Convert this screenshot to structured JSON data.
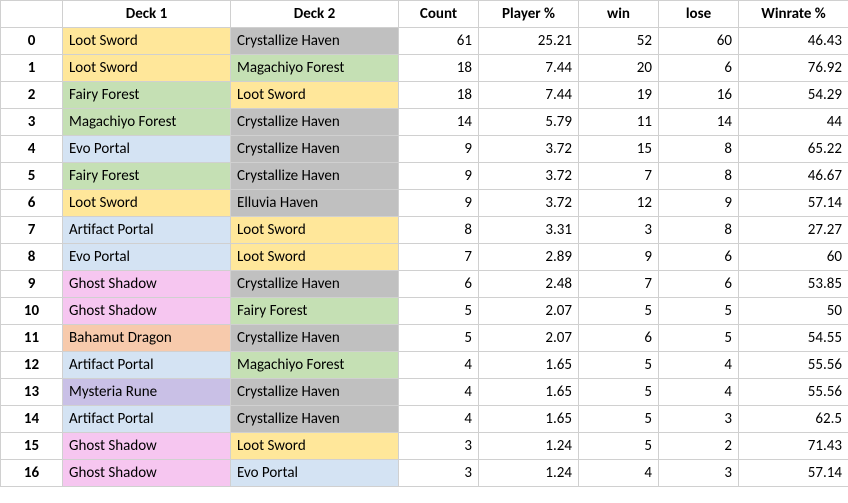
{
  "headers": {
    "idx": "",
    "deck1": "Deck 1",
    "deck2": "Deck 2",
    "count": "Count",
    "playerPct": "Player %",
    "win": "win",
    "lose": "lose",
    "winrate": "Winrate %"
  },
  "deckColors": {
    "Loot Sword": "sword",
    "Crystallize Haven": "haven",
    "Elluvia Haven": "haven",
    "Magachiyo Forest": "forest",
    "Fairy Forest": "forest",
    "Evo Portal": "portal",
    "Artifact Portal": "portal",
    "Ghost Shadow": "shadow",
    "Bahamut Dragon": "dragon",
    "Mysteria Rune": "rune"
  },
  "rows": [
    {
      "idx": "0",
      "deck1": "Loot Sword",
      "deck2": "Crystallize Haven",
      "count": "61",
      "playerPct": "25.21",
      "win": "52",
      "lose": "60",
      "winrate": "46.43"
    },
    {
      "idx": "1",
      "deck1": "Loot Sword",
      "deck2": "Magachiyo Forest",
      "count": "18",
      "playerPct": "7.44",
      "win": "20",
      "lose": "6",
      "winrate": "76.92"
    },
    {
      "idx": "2",
      "deck1": "Fairy Forest",
      "deck2": "Loot Sword",
      "count": "18",
      "playerPct": "7.44",
      "win": "19",
      "lose": "16",
      "winrate": "54.29"
    },
    {
      "idx": "3",
      "deck1": "Magachiyo Forest",
      "deck2": "Crystallize Haven",
      "count": "14",
      "playerPct": "5.79",
      "win": "11",
      "lose": "14",
      "winrate": "44"
    },
    {
      "idx": "4",
      "deck1": "Evo Portal",
      "deck2": "Crystallize Haven",
      "count": "9",
      "playerPct": "3.72",
      "win": "15",
      "lose": "8",
      "winrate": "65.22"
    },
    {
      "idx": "5",
      "deck1": "Fairy Forest",
      "deck2": "Crystallize Haven",
      "count": "9",
      "playerPct": "3.72",
      "win": "7",
      "lose": "8",
      "winrate": "46.67"
    },
    {
      "idx": "6",
      "deck1": "Loot Sword",
      "deck2": "Elluvia Haven",
      "count": "9",
      "playerPct": "3.72",
      "win": "12",
      "lose": "9",
      "winrate": "57.14"
    },
    {
      "idx": "7",
      "deck1": "Artifact Portal",
      "deck2": "Loot Sword",
      "count": "8",
      "playerPct": "3.31",
      "win": "3",
      "lose": "8",
      "winrate": "27.27"
    },
    {
      "idx": "8",
      "deck1": "Evo Portal",
      "deck2": "Loot Sword",
      "count": "7",
      "playerPct": "2.89",
      "win": "9",
      "lose": "6",
      "winrate": "60"
    },
    {
      "idx": "9",
      "deck1": "Ghost Shadow",
      "deck2": "Crystallize Haven",
      "count": "6",
      "playerPct": "2.48",
      "win": "7",
      "lose": "6",
      "winrate": "53.85"
    },
    {
      "idx": "10",
      "deck1": "Ghost Shadow",
      "deck2": "Fairy Forest",
      "count": "5",
      "playerPct": "2.07",
      "win": "5",
      "lose": "5",
      "winrate": "50"
    },
    {
      "idx": "11",
      "deck1": "Bahamut Dragon",
      "deck2": "Crystallize Haven",
      "count": "5",
      "playerPct": "2.07",
      "win": "6",
      "lose": "5",
      "winrate": "54.55"
    },
    {
      "idx": "12",
      "deck1": "Artifact Portal",
      "deck2": "Magachiyo Forest",
      "count": "4",
      "playerPct": "1.65",
      "win": "5",
      "lose": "4",
      "winrate": "55.56"
    },
    {
      "idx": "13",
      "deck1": "Mysteria Rune",
      "deck2": "Crystallize Haven",
      "count": "4",
      "playerPct": "1.65",
      "win": "5",
      "lose": "4",
      "winrate": "55.56"
    },
    {
      "idx": "14",
      "deck1": "Artifact Portal",
      "deck2": "Crystallize Haven",
      "count": "4",
      "playerPct": "1.65",
      "win": "5",
      "lose": "3",
      "winrate": "62.5"
    },
    {
      "idx": "15",
      "deck1": "Ghost Shadow",
      "deck2": "Loot Sword",
      "count": "3",
      "playerPct": "1.24",
      "win": "5",
      "lose": "2",
      "winrate": "71.43"
    },
    {
      "idx": "16",
      "deck1": "Ghost Shadow",
      "deck2": "Evo Portal",
      "count": "3",
      "playerPct": "1.24",
      "win": "4",
      "lose": "3",
      "winrate": "57.14"
    }
  ],
  "chart_data": {
    "type": "table",
    "columns": [
      "Deck 1",
      "Deck 2",
      "Count",
      "Player %",
      "win",
      "lose",
      "Winrate %"
    ],
    "rows": [
      [
        "Loot Sword",
        "Crystallize Haven",
        61,
        25.21,
        52,
        60,
        46.43
      ],
      [
        "Loot Sword",
        "Magachiyo Forest",
        18,
        7.44,
        20,
        6,
        76.92
      ],
      [
        "Fairy Forest",
        "Loot Sword",
        18,
        7.44,
        19,
        16,
        54.29
      ],
      [
        "Magachiyo Forest",
        "Crystallize Haven",
        14,
        5.79,
        11,
        14,
        44
      ],
      [
        "Evo Portal",
        "Crystallize Haven",
        9,
        3.72,
        15,
        8,
        65.22
      ],
      [
        "Fairy Forest",
        "Crystallize Haven",
        9,
        3.72,
        7,
        8,
        46.67
      ],
      [
        "Loot Sword",
        "Elluvia Haven",
        9,
        3.72,
        12,
        9,
        57.14
      ],
      [
        "Artifact Portal",
        "Loot Sword",
        8,
        3.31,
        3,
        8,
        27.27
      ],
      [
        "Evo Portal",
        "Loot Sword",
        7,
        2.89,
        9,
        6,
        60
      ],
      [
        "Ghost Shadow",
        "Crystallize Haven",
        6,
        2.48,
        7,
        6,
        53.85
      ],
      [
        "Ghost Shadow",
        "Fairy Forest",
        5,
        2.07,
        5,
        5,
        50
      ],
      [
        "Bahamut Dragon",
        "Crystallize Haven",
        5,
        2.07,
        6,
        5,
        54.55
      ],
      [
        "Artifact Portal",
        "Magachiyo Forest",
        4,
        1.65,
        5,
        4,
        55.56
      ],
      [
        "Mysteria Rune",
        "Crystallize Haven",
        4,
        1.65,
        5,
        4,
        55.56
      ],
      [
        "Artifact Portal",
        "Crystallize Haven",
        4,
        1.65,
        5,
        3,
        62.5
      ],
      [
        "Ghost Shadow",
        "Loot Sword",
        3,
        1.24,
        5,
        2,
        71.43
      ],
      [
        "Ghost Shadow",
        "Evo Portal",
        3,
        1.24,
        4,
        3,
        57.14
      ]
    ]
  }
}
